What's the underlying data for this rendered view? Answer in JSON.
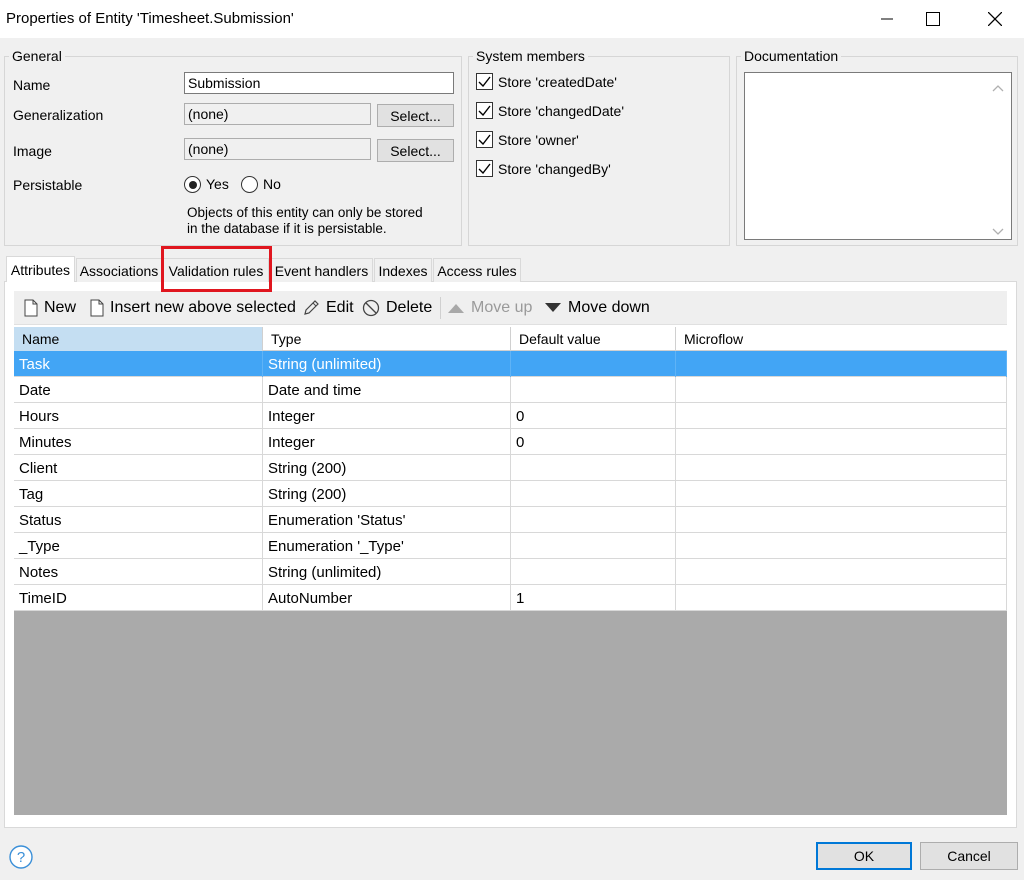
{
  "window": {
    "title": "Properties of Entity 'Timesheet.Submission'",
    "controls": [
      "minimize-icon",
      "maximize-icon",
      "close-icon"
    ]
  },
  "general": {
    "title": "General",
    "name_label": "Name",
    "name_value": "Submission",
    "generalization_label": "Generalization",
    "generalization_value": "(none)",
    "image_label": "Image",
    "image_value": "(none)",
    "select_label": "Select...",
    "persistable_label": "Persistable",
    "yes_label": "Yes",
    "no_label": "No",
    "persistable_selected": "Yes",
    "note_line1": "Objects of this entity can only be stored",
    "note_line2": "in the database if it is persistable."
  },
  "system_members": {
    "title": "System members",
    "items": [
      {
        "label": "Store 'createdDate'",
        "checked": true
      },
      {
        "label": "Store 'changedDate'",
        "checked": true
      },
      {
        "label": "Store 'owner'",
        "checked": true
      },
      {
        "label": "Store 'changedBy'",
        "checked": true
      }
    ]
  },
  "documentation": {
    "title": "Documentation",
    "value": ""
  },
  "tabs": [
    {
      "label": "Attributes",
      "active": true
    },
    {
      "label": "Associations",
      "active": false
    },
    {
      "label": "Validation rules",
      "active": false
    },
    {
      "label": "Event handlers",
      "active": false
    },
    {
      "label": "Indexes",
      "active": false
    },
    {
      "label": "Access rules",
      "active": false
    }
  ],
  "toolbar": {
    "new_label": "New",
    "insert_label": "Insert new above selected",
    "edit_label": "Edit",
    "delete_label": "Delete",
    "move_up_label": "Move up",
    "move_down_label": "Move down"
  },
  "grid": {
    "columns": [
      "Name",
      "Type",
      "Default value",
      "Microflow"
    ],
    "rows": [
      {
        "name": "Task",
        "type": "String (unlimited)",
        "default": "",
        "microflow": "",
        "selected": true
      },
      {
        "name": "Date",
        "type": "Date and time",
        "default": "",
        "microflow": ""
      },
      {
        "name": "Hours",
        "type": "Integer",
        "default": "0",
        "microflow": ""
      },
      {
        "name": "Minutes",
        "type": "Integer",
        "default": "0",
        "microflow": ""
      },
      {
        "name": "Client",
        "type": "String (200)",
        "default": "",
        "microflow": ""
      },
      {
        "name": "Tag",
        "type": "String (200)",
        "default": "",
        "microflow": ""
      },
      {
        "name": "Status",
        "type": "Enumeration 'Status'",
        "default": "",
        "microflow": ""
      },
      {
        "name": "_Type",
        "type": "Enumeration '_Type'",
        "default": "",
        "microflow": ""
      },
      {
        "name": "Notes",
        "type": "String (unlimited)",
        "default": "",
        "microflow": ""
      },
      {
        "name": "TimeID",
        "type": "AutoNumber",
        "default": "1",
        "microflow": ""
      }
    ]
  },
  "footer": {
    "ok_label": "OK",
    "cancel_label": "Cancel"
  },
  "colors": {
    "selection": "#42a5f5",
    "highlight": "#e0161f",
    "default_button_border": "#0078d7"
  }
}
